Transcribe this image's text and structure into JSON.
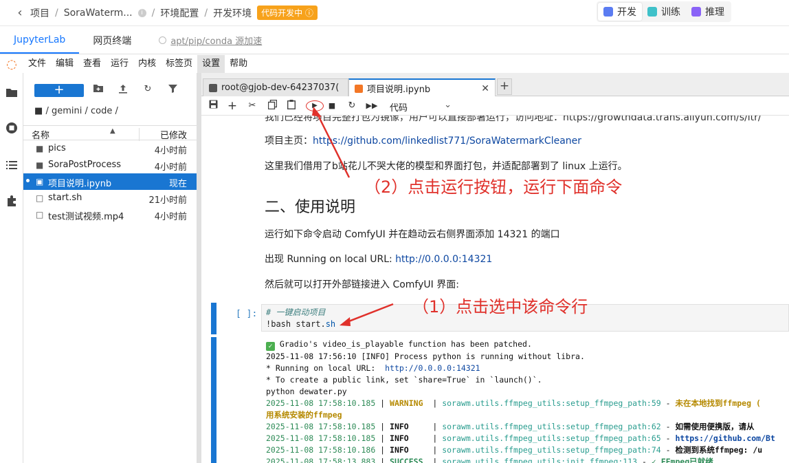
{
  "breadcrumb": {
    "items": [
      "项目",
      "SoraWaterm...",
      "环境配置",
      "开发环境"
    ],
    "badge": "代码开发中"
  },
  "modes": [
    {
      "label": "开发",
      "color": "#5b7cf2"
    },
    {
      "label": "训练",
      "color": "#3fc1c9"
    },
    {
      "label": "推理",
      "color": "#8a63f7"
    }
  ],
  "subtabs": [
    {
      "label": "JupyterLab"
    },
    {
      "label": "网页终端"
    },
    {
      "label": "apt/pip/conda 源加速"
    }
  ],
  "menu": [
    "文件",
    "编辑",
    "查看",
    "运行",
    "内核",
    "标签页",
    "设置",
    "帮助"
  ],
  "filebrowser": {
    "path": "/ gemini / code /",
    "col_name": "名称",
    "col_modified": "已修改",
    "files": [
      {
        "name": "pics",
        "time": "4小时前",
        "icon": "folder"
      },
      {
        "name": "SoraPostProcess",
        "time": "4小时前",
        "icon": "folder"
      },
      {
        "name": "项目说明.ipynb",
        "time": "现在",
        "icon": "notebook"
      },
      {
        "name": "start.sh",
        "time": "21小时前",
        "icon": "file"
      },
      {
        "name": "test测试视频.mp4",
        "time": "4小时前",
        "icon": "file"
      }
    ]
  },
  "notebook_tabs": [
    {
      "label": "root@gjob-dev-64237037("
    },
    {
      "label": "项目说明.ipynb"
    }
  ],
  "toolbar": {
    "cell_type": "代码"
  },
  "markdown": {
    "line0": "我们已经将项目完整打包为镜像，用户可以直接部署运行，访问地址：https://growthdata.trans.aliyun.com/s/ltr/",
    "homepage_label": "项目主页：",
    "homepage_url": "https://github.com/linkedlist771/SoraWatermarkCleaner",
    "credit": "这里我们借用了b站花儿不哭大佬的模型和界面打包，并适配部署到了 linux 上运行。",
    "section": "二、使用说明",
    "run_desc": "运行如下命令启动 ComfyUI 并在趋动云右侧界面添加 14321 的端口",
    "appear_prefix": "出现 Running on local URL: ",
    "appear_url": "http://0.0.0.0:14321",
    "then": "然后就可以打开外部链接进入 ComfyUI 界面:"
  },
  "code_cell": {
    "prompt": "[ ]:",
    "comment": "# 一键启动项目",
    "cmd_prefix": "!bash start.",
    "cmd_ext": "sh"
  },
  "output": {
    "l1": " Gradio's video_is_playable function has been patched.",
    "l2": "2025-11-08 17:56:10 [INFO] Process python is running without libra.",
    "l3a": "* Running on local URL:  ",
    "l3b": "http://0.0.0.0:14321",
    "l4": "* To create a public link, set `share=True` in `launch()`.",
    "l5": "python dewater.py",
    "rows": [
      {
        "ts": "2025-11-08 17:58:10.185",
        "lvl": "WARNING ",
        "src": "sorawm.utils.ffmpeg_utils:setup_ffmpeg_path:59",
        "msg": "未在本地找到ffmpeg ("
      },
      {
        "ts": "",
        "lvl": "",
        "src": "",
        "msg": "用系统安装的ffmpeg"
      },
      {
        "ts": "2025-11-08 17:58:10.185",
        "lvl": "INFO    ",
        "src": "sorawm.utils.ffmpeg_utils:setup_ffmpeg_path:62",
        "msg": "如需使用便携版，请从"
      },
      {
        "ts": "2025-11-08 17:58:10.185",
        "lvl": "INFO    ",
        "src": "sorawm.utils.ffmpeg_utils:setup_ffmpeg_path:65",
        "msg": "https://github.com/Bt"
      },
      {
        "ts": "2025-11-08 17:58:10.186",
        "lvl": "INFO    ",
        "src": "sorawm.utils.ffmpeg_utils:setup_ffmpeg_path:74",
        "msg": "检测到系统ffmpeg: /u"
      },
      {
        "ts": "2025-11-08 17:58:13.883",
        "lvl": "SUCCESS ",
        "src": "sorawm.utils.ffmpeg_utils:init_ffmpeg:113",
        "msg": "✓ FFmpeg已就绪"
      }
    ]
  },
  "annotations": {
    "a2": "（2）点击运行按钮，运行下面命令",
    "a1": "（1）点击选中该命令行"
  },
  "colors": {
    "accent": "#1976d2",
    "badge": "#f7a21b",
    "annotation": "#e0312b"
  }
}
